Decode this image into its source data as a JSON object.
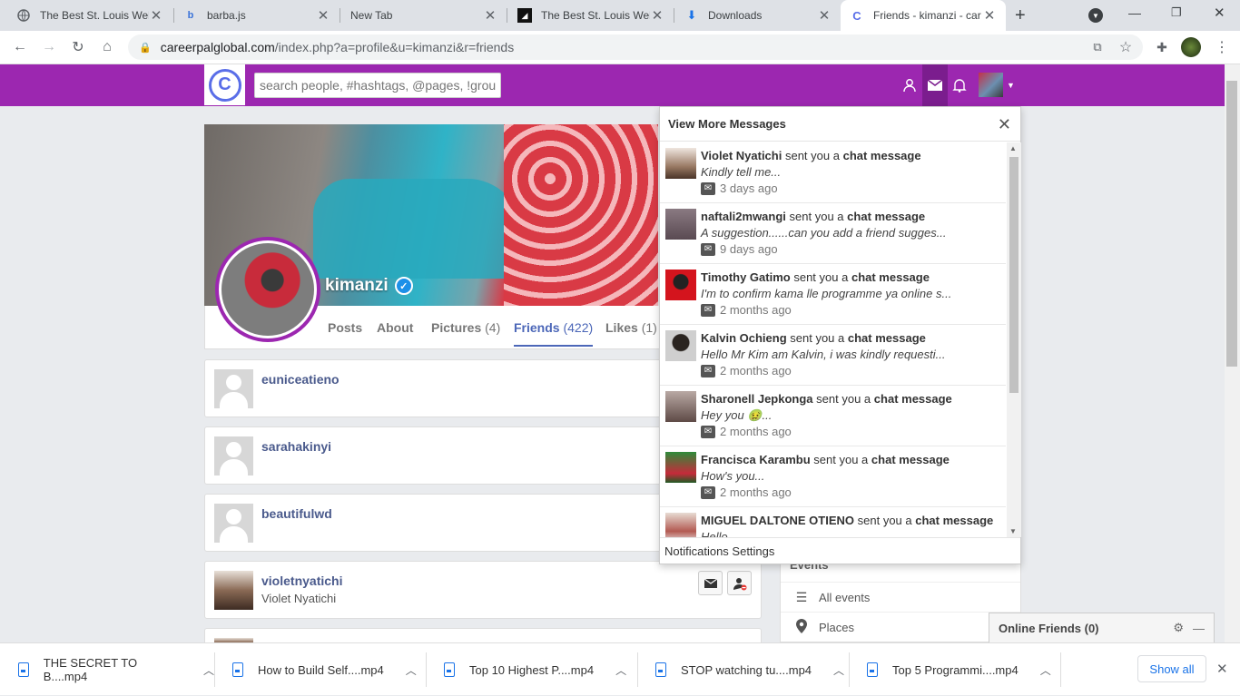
{
  "browser": {
    "tabs": [
      {
        "title": "The Best St. Louis Web",
        "icon": "globe-icon"
      },
      {
        "title": "barba.js",
        "icon": "barba-icon"
      },
      {
        "title": "New Tab",
        "icon": ""
      },
      {
        "title": "The Best St. Louis Web",
        "icon": "dark-site-icon"
      },
      {
        "title": "Downloads",
        "icon": "download-icon"
      },
      {
        "title": "Friends - kimanzi - car",
        "icon": "careerpal-icon"
      }
    ],
    "url_host": "careerpalglobal.com",
    "url_path": "/index.php?a=profile&u=kimanzi&r=friends"
  },
  "site": {
    "search_placeholder": "search people, #hashtags, @pages, !groups",
    "brand_color": "#9c27b0"
  },
  "profile": {
    "name": "kimanzi",
    "tabs": [
      {
        "label": "Posts",
        "count": ""
      },
      {
        "label": "About",
        "count": ""
      },
      {
        "label": "Pictures",
        "count": "(4)"
      },
      {
        "label": "Friends",
        "count": "(422)"
      },
      {
        "label": "Likes",
        "count": "(1)"
      }
    ]
  },
  "friends": [
    {
      "username": "euniceatieno",
      "fullname": ""
    },
    {
      "username": "sarahakinyi",
      "fullname": ""
    },
    {
      "username": "beautifulwd",
      "fullname": ""
    },
    {
      "username": "violetnyatichi",
      "fullname": "Violet Nyatichi"
    }
  ],
  "messages": {
    "header": "View More Messages",
    "sent_text": "sent you a",
    "kind": "chat message",
    "items": [
      {
        "sender": "Violet Nyatichi",
        "preview": "Kindly tell me...",
        "time": "3 days ago"
      },
      {
        "sender": "naftali2mwangi",
        "preview": "A suggestion......can you add a friend sugges...",
        "time": "9 days ago"
      },
      {
        "sender": "Timothy Gatimo",
        "preview": "I'm to confirm kama lle programme ya online s...",
        "time": "2 months ago"
      },
      {
        "sender": "Kalvin Ochieng",
        "preview": "Hello Mr Kim am Kalvin, i was kindly requesti...",
        "time": "2 months ago"
      },
      {
        "sender": "Sharonell Jepkonga",
        "preview": "Hey you 🤢...",
        "time": "2 months ago"
      },
      {
        "sender": "Francisca Karambu",
        "preview": "How's you...",
        "time": "2 months ago"
      },
      {
        "sender": "MIGUEL DALTONE OTIENO",
        "preview": "Hello...",
        "time": ""
      }
    ],
    "footer": "Notifications Settings"
  },
  "sidebar": {
    "events_header": "Events",
    "items": [
      {
        "label": "All events",
        "icon": "list-icon"
      },
      {
        "label": "Places",
        "icon": "map-pin-icon"
      }
    ]
  },
  "online_friends": {
    "label": "Online Friends (0)"
  },
  "downloads": {
    "items": [
      "THE SECRET TO B....mp4",
      "How to Build Self....mp4",
      "Top 10 Highest P....mp4",
      "STOP watching tu....mp4",
      "Top 5 Programmi....mp4"
    ],
    "show_all": "Show all"
  }
}
